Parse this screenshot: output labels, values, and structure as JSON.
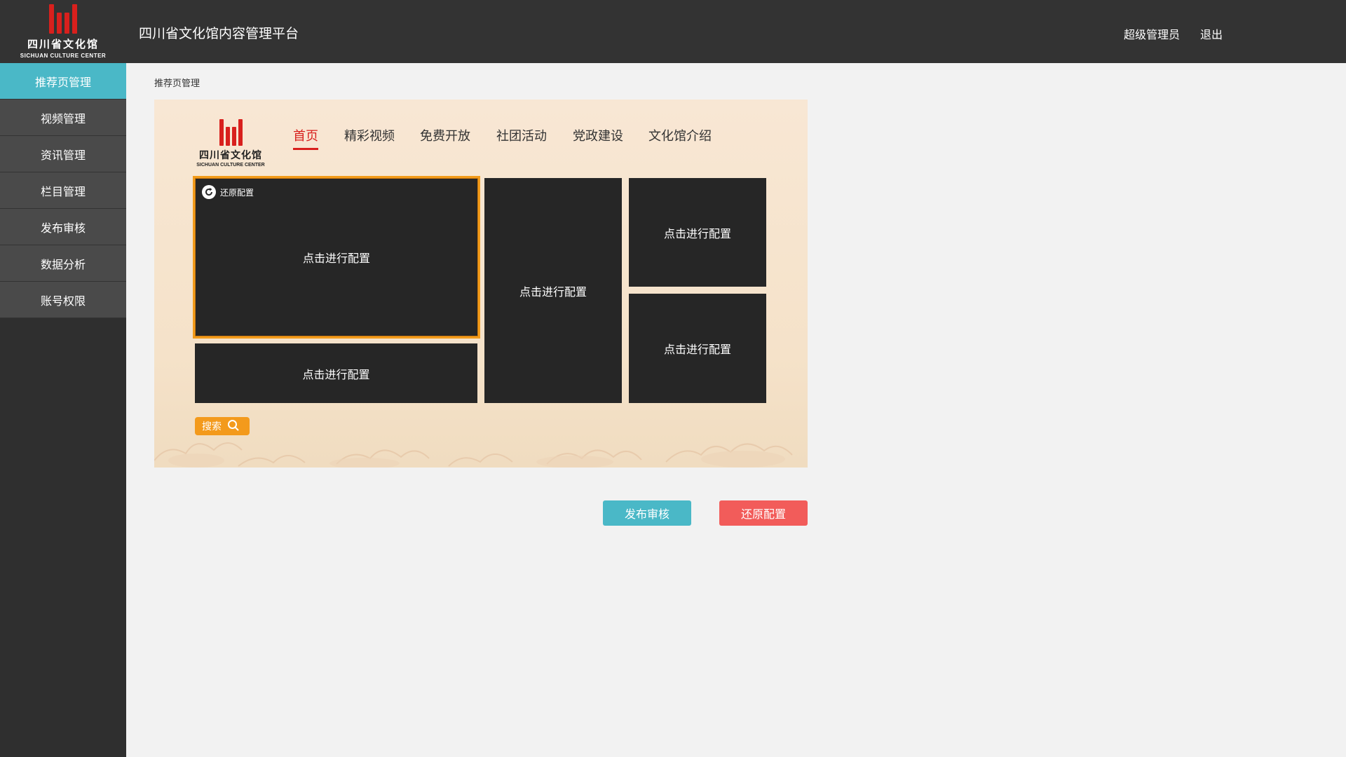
{
  "header": {
    "logo_name": "四川省文化馆",
    "logo_sub": "SICHUAN CULTURE CENTER",
    "title": "四川省文化馆内容管理平台",
    "user": "超级管理员",
    "logout": "退出"
  },
  "sidebar": {
    "items": [
      {
        "label": "推荐页管理",
        "active": true
      },
      {
        "label": "视频管理"
      },
      {
        "label": "资讯管理"
      },
      {
        "label": "栏目管理"
      },
      {
        "label": "发布审核"
      },
      {
        "label": "数据分析"
      },
      {
        "label": "账号权限"
      }
    ]
  },
  "breadcrumb": "推荐页管理",
  "preview": {
    "logo_name": "四川省文化馆",
    "logo_sub": "SICHUAN CULTURE CENTER",
    "nav": [
      "首页",
      "精彩视频",
      "免费开放",
      "社团活动",
      "党政建设",
      "文化馆介绍"
    ],
    "active_nav": "首页",
    "reset_chip": "还原配置",
    "tiles": [
      "点击进行配置",
      "点击进行配置",
      "点击进行配置",
      "点击进行配置",
      "点击进行配置"
    ],
    "search_label": "搜索"
  },
  "actions": {
    "publish": "发布审核",
    "reset": "还原配置"
  },
  "colors": {
    "topbar": "#333333",
    "sidebar_active": "#4ab8c7",
    "accent_red": "#d8201d",
    "selection_orange": "#f29b1a",
    "publish_button": "#4ab8c7",
    "reset_button": "#f25c5a"
  }
}
